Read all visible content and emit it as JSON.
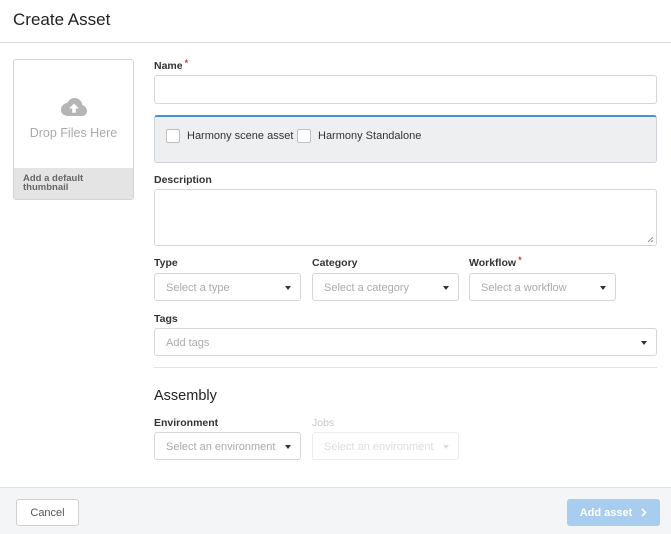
{
  "dialog": {
    "title": "Create Asset"
  },
  "thumbnail": {
    "drop_text": "Drop Files Here",
    "default_label": "Add a default thumbnail",
    "icon": "cloud-upload-icon"
  },
  "form": {
    "name": {
      "label": "Name",
      "required_mark": "*",
      "value": ""
    },
    "harmony_options": [
      {
        "label": "Harmony scene asset",
        "checked": false
      },
      {
        "label": "Harmony Standalone",
        "checked": false
      }
    ],
    "description": {
      "label": "Description",
      "value": ""
    },
    "type": {
      "label": "Type",
      "placeholder": "Select a type"
    },
    "category": {
      "label": "Category",
      "placeholder": "Select a category"
    },
    "workflow": {
      "label": "Workflow",
      "required_mark": "*",
      "placeholder": "Select a workflow"
    },
    "tags": {
      "label": "Tags",
      "placeholder": "Add tags"
    }
  },
  "assembly": {
    "title": "Assembly",
    "environment": {
      "label": "Environment",
      "placeholder": "Select an environment"
    },
    "jobs": {
      "label": "Jobs",
      "placeholder": "Select an environment",
      "disabled": true
    }
  },
  "footer": {
    "cancel_label": "Cancel",
    "add_label": "Add asset",
    "add_icon": "chevron-right-icon"
  },
  "colors": {
    "accent_border": "#4a90d9",
    "required": "#dd3333",
    "primary_button_disabled": "#a9cdee"
  }
}
